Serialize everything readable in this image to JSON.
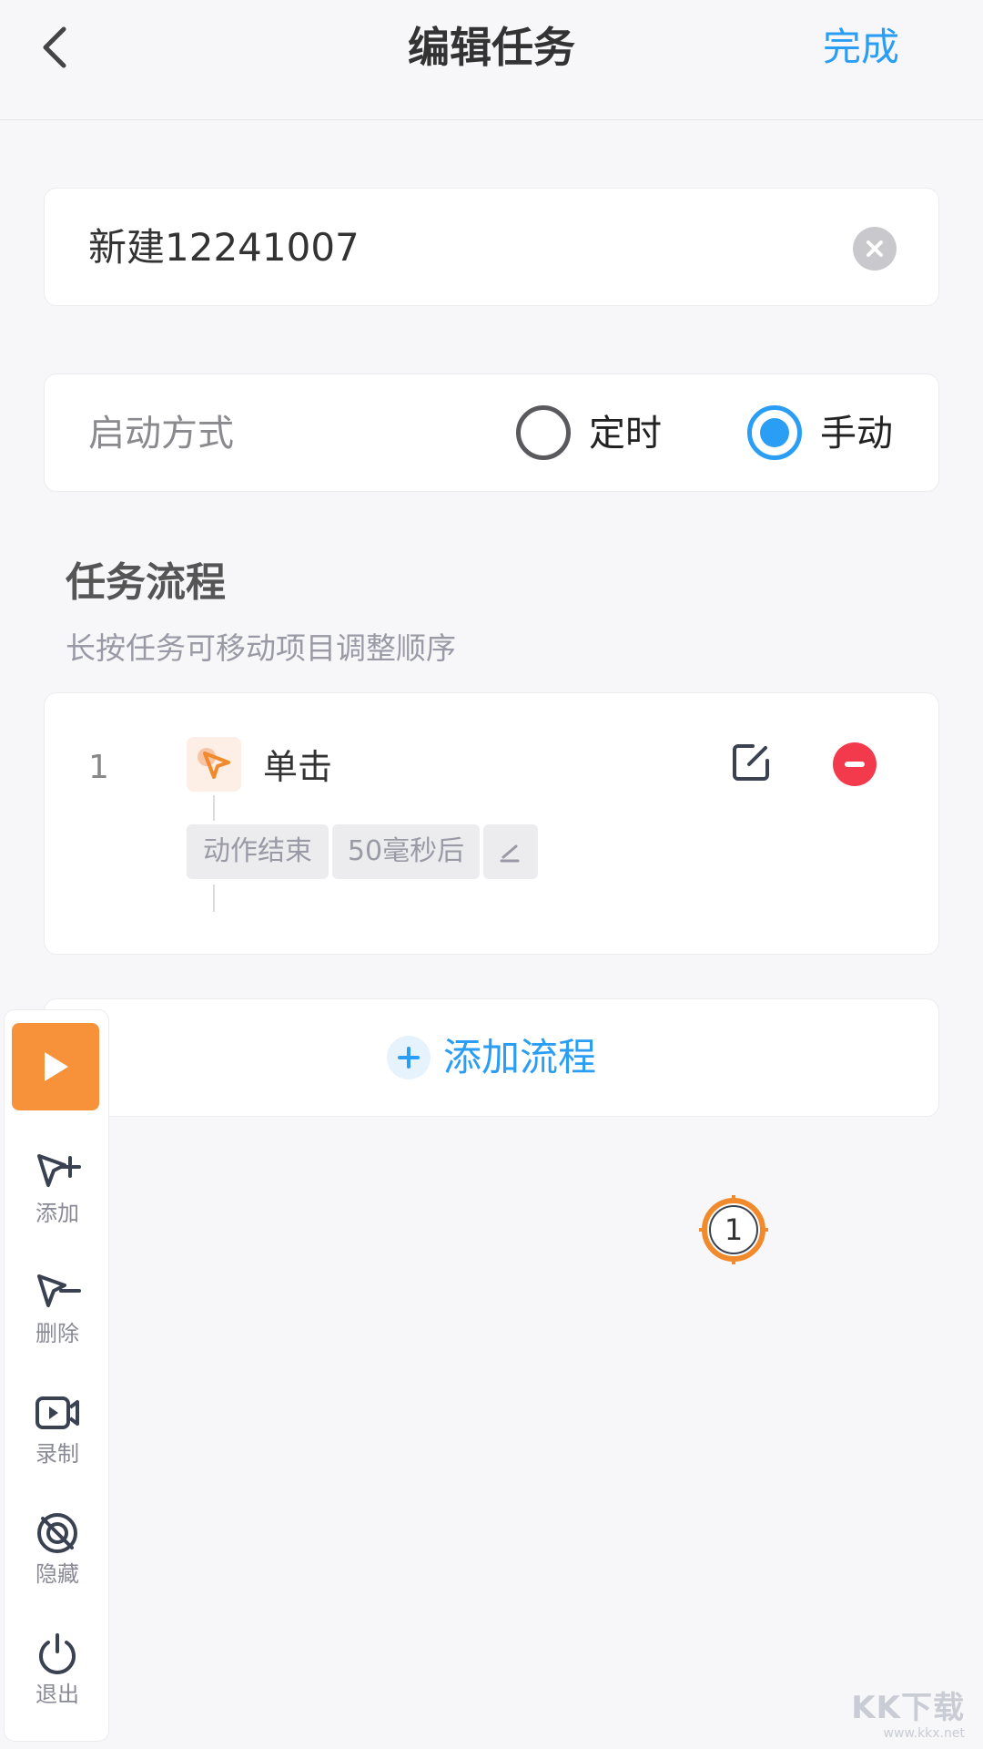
{
  "header": {
    "title": "编辑任务",
    "done_label": "完成",
    "back_icon": "chevron-left-icon"
  },
  "task": {
    "name": "新建12241007",
    "clear_icon": "clear-icon"
  },
  "launch": {
    "label": "启动方式",
    "options": [
      {
        "label": "定时",
        "selected": false
      },
      {
        "label": "手动",
        "selected": true
      }
    ]
  },
  "flow": {
    "title": "任务流程",
    "subtitle": "长按任务可移动项目调整顺序",
    "steps": [
      {
        "num": "1",
        "label": "单击",
        "icon": "tap-cursor-icon",
        "tags": [
          "动作结束",
          "50毫秒后"
        ]
      }
    ],
    "add_label": "添加流程"
  },
  "toolbar": {
    "items": [
      {
        "label": "添加",
        "icon": "cursor-plus-icon"
      },
      {
        "label": "删除",
        "icon": "cursor-minus-icon"
      },
      {
        "label": "录制",
        "icon": "record-icon"
      },
      {
        "label": "隐藏",
        "icon": "hide-icon"
      },
      {
        "label": "退出",
        "icon": "power-icon"
      }
    ]
  },
  "target_marker": {
    "number": "1"
  },
  "watermark": {
    "logo": "KK下载",
    "url": "www.kkx.net"
  },
  "colors": {
    "accent": "#2a9df4",
    "play": "#f7923a",
    "delete": "#f23a4c",
    "marker": "#f08a2c"
  }
}
